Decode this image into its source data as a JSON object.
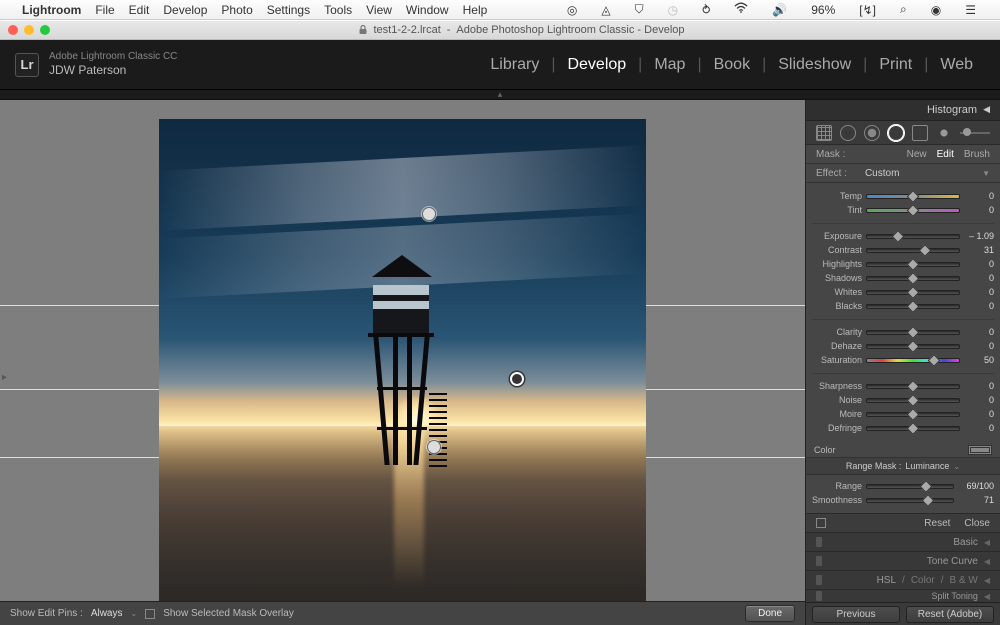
{
  "mac_menu": {
    "app_name": "Lightroom",
    "items": [
      "File",
      "Edit",
      "Develop",
      "Photo",
      "Settings",
      "Tools",
      "View",
      "Window",
      "Help"
    ],
    "battery": "96%",
    "charging_icon": "[↯]"
  },
  "window": {
    "doc_name": "test1-2-2.lrcat",
    "title_suffix": "Adobe Photoshop Lightroom Classic - Develop"
  },
  "branding": {
    "product": "Adobe Lightroom Classic CC",
    "user": "JDW Paterson",
    "logo_text": "Lr"
  },
  "modules": {
    "items": [
      "Library",
      "Develop",
      "Map",
      "Book",
      "Slideshow",
      "Print",
      "Web"
    ],
    "active_index": 1
  },
  "panel": {
    "histogram_label": "Histogram",
    "mask": {
      "label": "Mask :",
      "new": "New",
      "edit": "Edit",
      "brush": "Brush",
      "active": "Edit"
    },
    "effect": {
      "label": "Effect :",
      "value": "Custom"
    },
    "sliders": {
      "temp": {
        "label": "Temp",
        "value": 0,
        "pos": 50
      },
      "tint": {
        "label": "Tint",
        "value": 0,
        "pos": 50
      },
      "exposure": {
        "label": "Exposure",
        "value": "– 1.09",
        "pos": 34
      },
      "contrast": {
        "label": "Contrast",
        "value": 31,
        "pos": 63
      },
      "highlights": {
        "label": "Highlights",
        "value": 0,
        "pos": 50
      },
      "shadows": {
        "label": "Shadows",
        "value": 0,
        "pos": 50
      },
      "whites": {
        "label": "Whites",
        "value": 0,
        "pos": 50
      },
      "blacks": {
        "label": "Blacks",
        "value": 0,
        "pos": 50
      },
      "clarity": {
        "label": "Clarity",
        "value": 0,
        "pos": 50
      },
      "dehaze": {
        "label": "Dehaze",
        "value": 0,
        "pos": 50
      },
      "saturation": {
        "label": "Saturation",
        "value": 50,
        "pos": 73
      },
      "sharpness": {
        "label": "Sharpness",
        "value": 0,
        "pos": 50
      },
      "noise": {
        "label": "Noise",
        "value": 0,
        "pos": 50
      },
      "moire": {
        "label": "Moire",
        "value": 0,
        "pos": 50
      },
      "defringe": {
        "label": "Defringe",
        "value": 0,
        "pos": 50
      }
    },
    "color_label": "Color",
    "range_mask": {
      "header_label": "Range Mask :",
      "header_value": "Luminance",
      "range": {
        "label": "Range",
        "value": "69/100",
        "pos": 69
      },
      "smoothness": {
        "label": "Smoothness",
        "value": 71,
        "pos": 71
      }
    },
    "footer": {
      "reset": "Reset",
      "close": "Close"
    },
    "sections": {
      "basic": "Basic",
      "tone_curve": "Tone Curve",
      "hsl": "HSL",
      "color": "Color",
      "bw": "B & W",
      "split_toning": "Split Toning"
    },
    "buttons": {
      "previous": "Previous",
      "reset_adobe": "Reset (Adobe)"
    }
  },
  "bottom_bar": {
    "show_pins_label": "Show Edit Pins :",
    "show_pins_value": "Always",
    "overlay_label": "Show Selected Mask Overlay",
    "done": "Done"
  }
}
